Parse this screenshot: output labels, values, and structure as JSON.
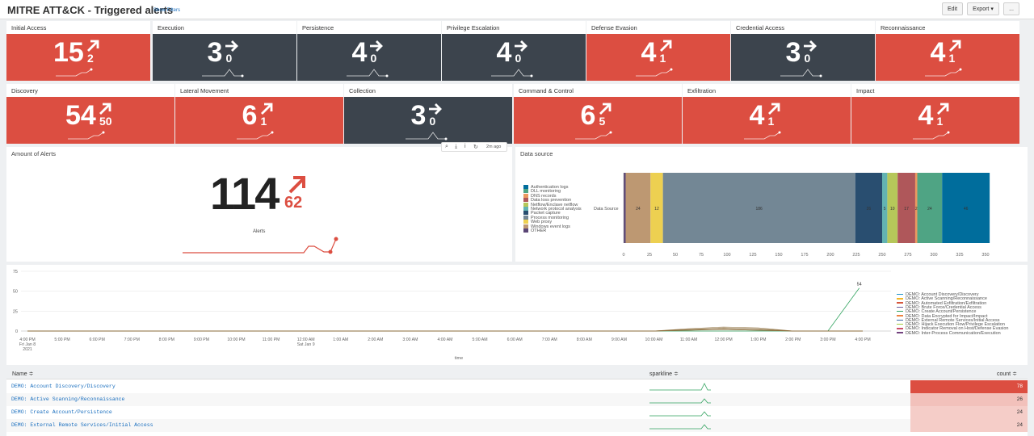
{
  "header": {
    "title": "MITRE ATT&CK - Triggered alerts",
    "show_filters": "Show Filters",
    "edit": "Edit",
    "export": "Export ▾",
    "more": "..."
  },
  "tiles": [
    {
      "label": "Initial Access",
      "value": "15",
      "delta": "2",
      "trend": "up",
      "color": "red"
    },
    {
      "label": "Execution",
      "value": "3",
      "delta": "0",
      "trend": "flat",
      "color": "dark"
    },
    {
      "label": "Persistence",
      "value": "4",
      "delta": "0",
      "trend": "flat",
      "color": "dark"
    },
    {
      "label": "Privilege Escalation",
      "value": "4",
      "delta": "0",
      "trend": "flat",
      "color": "dark"
    },
    {
      "label": "Defense Evasion",
      "value": "4",
      "delta": "1",
      "trend": "up",
      "color": "red"
    },
    {
      "label": "Credential Access",
      "value": "3",
      "delta": "0",
      "trend": "flat",
      "color": "dark"
    },
    {
      "label": "Reconnaissance",
      "value": "4",
      "delta": "1",
      "trend": "up",
      "color": "red"
    },
    {
      "label": "Discovery",
      "value": "54",
      "delta": "50",
      "trend": "up",
      "color": "red"
    },
    {
      "label": "Lateral Movement",
      "value": "6",
      "delta": "1",
      "trend": "up",
      "color": "red"
    },
    {
      "label": "Collection",
      "value": "3",
      "delta": "0",
      "trend": "flat",
      "color": "dark"
    },
    {
      "label": "Command & Control",
      "value": "6",
      "delta": "5",
      "trend": "up",
      "color": "red"
    },
    {
      "label": "Exfiltration",
      "value": "4",
      "delta": "1",
      "trend": "up",
      "color": "red"
    },
    {
      "label": "Impact",
      "value": "4",
      "delta": "1",
      "trend": "up",
      "color": "red"
    }
  ],
  "amount": {
    "title": "Amount of Alerts",
    "value": "114",
    "delta": "62",
    "caption": "Alerts",
    "toolbar_time": "2m ago"
  },
  "datasource": {
    "title": "Data source",
    "row_label": "Data Source",
    "legend": [
      {
        "label": "Authentication logs",
        "color": "#006d9c"
      },
      {
        "label": "DLL monitoring",
        "color": "#4fa484"
      },
      {
        "label": "DNS records",
        "color": "#ec9960"
      },
      {
        "label": "Data loss prevention",
        "color": "#af575a"
      },
      {
        "label": "Netflow/Enclave netflow",
        "color": "#b6c75a"
      },
      {
        "label": "Network protocol analysis",
        "color": "#62b3b2"
      },
      {
        "label": "Packet capture",
        "color": "#294e70"
      },
      {
        "label": "Process monitoring",
        "color": "#738795"
      },
      {
        "label": "Web proxy",
        "color": "#edd051"
      },
      {
        "label": "Windows event logs",
        "color": "#bd9872"
      },
      {
        "label": "OTHER",
        "color": "#5a4575"
      }
    ],
    "segments": [
      {
        "value": 2,
        "color": "#5a4575",
        "label": ""
      },
      {
        "value": 24,
        "color": "#bd9872",
        "label": "24"
      },
      {
        "value": 12,
        "color": "#edd051",
        "label": "12"
      },
      {
        "value": 186,
        "color": "#738795",
        "label": "186"
      },
      {
        "value": 26,
        "color": "#294e70",
        "label": "26"
      },
      {
        "value": 5,
        "color": "#62b3b2",
        "label": "5"
      },
      {
        "value": 10,
        "color": "#b6c75a",
        "label": "10"
      },
      {
        "value": 17,
        "color": "#af575a",
        "label": "17"
      },
      {
        "value": 2,
        "color": "#ec9960",
        "label": "2"
      },
      {
        "value": 24,
        "color": "#4fa484",
        "label": "24"
      },
      {
        "value": 46,
        "color": "#006d9c",
        "label": "46"
      }
    ],
    "ticks": [
      "0",
      "25",
      "50",
      "75",
      "100",
      "125",
      "150",
      "175",
      "200",
      "225",
      "250",
      "275",
      "300",
      "325",
      "350",
      "375"
    ]
  },
  "timeline": {
    "y_ticks": [
      "75",
      "50",
      "25",
      "0"
    ],
    "x_ticks": [
      "4:00 PM\nFri Jan 8\n2021",
      "5:00 PM",
      "6:00 PM",
      "7:00 PM",
      "8:00 PM",
      "9:00 PM",
      "10:00 PM",
      "11:00 PM",
      "12:00 AM\nSat Jan 9",
      "1:00 AM",
      "2:00 AM",
      "3:00 AM",
      "4:00 AM",
      "5:00 AM",
      "6:00 AM",
      "7:00 AM",
      "8:00 AM",
      "9:00 AM",
      "10:00 AM",
      "11:00 AM",
      "12:00 PM",
      "1:00 PM",
      "2:00 PM",
      "3:00 PM",
      "4:00 PM"
    ],
    "x_label": "time",
    "peak_label": "54",
    "legend": [
      {
        "label": "DEMO: Account Discovery/Discovery",
        "color": "#1e93c6"
      },
      {
        "label": "DEMO: Active Scanning/Reconnaissance",
        "color": "#f2b827"
      },
      {
        "label": "DEMO: Automated Exfiltration/Exfiltration",
        "color": "#d6563c"
      },
      {
        "label": "DEMO: Brute Force/Credential Access",
        "color": "#6a5c9e"
      },
      {
        "label": "DEMO: Create Account/Persistence",
        "color": "#31a35f"
      },
      {
        "label": "DEMO: Data Encrypted for Impact/Impact",
        "color": "#ed8440"
      },
      {
        "label": "DEMO: External Remote Services/Initial Access",
        "color": "#3863a0"
      },
      {
        "label": "DEMO: Hijack Execution Flow/Privilege Escalation",
        "color": "#a2cc3e"
      },
      {
        "label": "DEMO: Indicator Removal on Host/Defense Evasion",
        "color": "#cc5068"
      },
      {
        "label": "DEMO: Inter-Process Communication/Execution",
        "color": "#73427f"
      }
    ]
  },
  "table": {
    "headers": [
      "Name ≑",
      "sparkline ≑",
      "count ≑"
    ],
    "rows": [
      {
        "name": "DEMO: Account Discovery/Discovery",
        "count": "78"
      },
      {
        "name": "DEMO: Active Scanning/Reconnaissance",
        "count": "26"
      },
      {
        "name": "DEMO: Create Account/Persistence",
        "count": "24"
      },
      {
        "name": "DEMO: External Remote Services/Initial Access",
        "count": "24"
      }
    ]
  },
  "colors": {
    "red": "#dc4e41",
    "dark": "#3c444d",
    "accent": "#1a6fbf"
  }
}
